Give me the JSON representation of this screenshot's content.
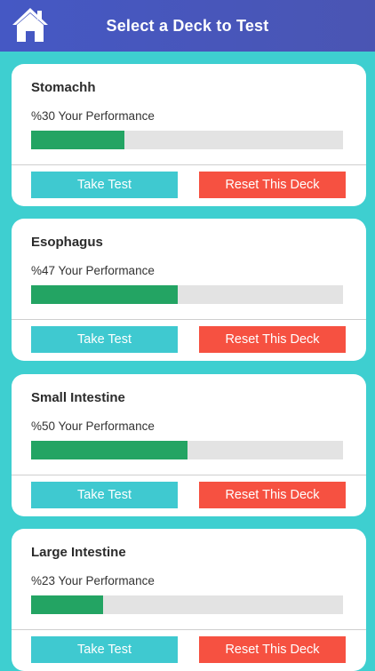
{
  "header": {
    "title": "Select a Deck to Test",
    "home_icon": "home-icon"
  },
  "colors": {
    "header": "#4558c4",
    "background": "#3ecfd0",
    "progress_fill": "#23a463",
    "progress_track": "#e3e3e3",
    "take_test": "#3fc9d0",
    "reset": "#f65141"
  },
  "decks": [
    {
      "name": "Stomachh",
      "performance_text": "%30 Your Performance",
      "performance": 30,
      "take_label": "Take Test",
      "reset_label": "Reset This Deck"
    },
    {
      "name": "Esophagus",
      "performance_text": "%47 Your Performance",
      "performance": 47,
      "take_label": "Take Test",
      "reset_label": "Reset This Deck"
    },
    {
      "name": "Small Intestine",
      "performance_text": "%50 Your Performance",
      "performance": 50,
      "take_label": "Take Test",
      "reset_label": "Reset This Deck"
    },
    {
      "name": "Large Intestine",
      "performance_text": "%23 Your Performance",
      "performance": 23,
      "take_label": "Take Test",
      "reset_label": "Reset This Deck"
    }
  ]
}
